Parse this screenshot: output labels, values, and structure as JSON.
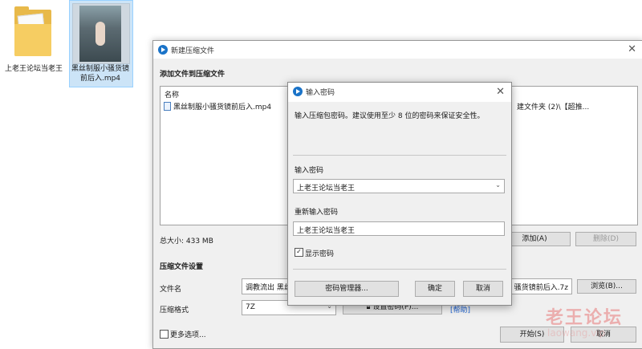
{
  "desktop": {
    "icons": [
      {
        "label": "上老王论坛当老王"
      },
      {
        "label": "黑丝制服小骚货镜前后入.mp4"
      }
    ]
  },
  "main_dialog": {
    "title": "新建压缩文件",
    "section_add": "添加文件到压缩文件",
    "list_header": "名称",
    "file_name": "黑丝制服小骚货镜前后入.mp4",
    "file_right_text": "建文件夹 (2)\\【超推...",
    "total_size": "总大小: 433 MB",
    "add_button": "添加(A)",
    "remove_button": "删除(D)",
    "section_settings": "压缩文件设置",
    "filename_label": "文件名",
    "filename_value_left": "调教流出 黑丝",
    "filename_value_right": "骚货镜前后入.7z",
    "browse_button": "浏览(B)...",
    "format_label": "压缩格式",
    "format_value": "7Z",
    "set_password_button": "设置密码(P)...",
    "help_link": "[帮助]",
    "more_options": "更多选项...",
    "start_button": "开始(S)",
    "cancel_button": "取消"
  },
  "password_dialog": {
    "title": "输入密码",
    "description": "输入压缩包密码。建议使用至少 8 位的密码来保证安全性。",
    "password_label": "输入密码",
    "password_value": "上老王论坛当老王",
    "confirm_label": "重新输入密码",
    "confirm_value": "上老王论坛当老王",
    "show_password": "显示密码",
    "show_password_checked": true,
    "manager_button": "密码管理器...",
    "ok_button": "确定",
    "cancel_button": "取消"
  },
  "watermark": {
    "main": "老王论坛",
    "sub": "laowang.vip"
  }
}
